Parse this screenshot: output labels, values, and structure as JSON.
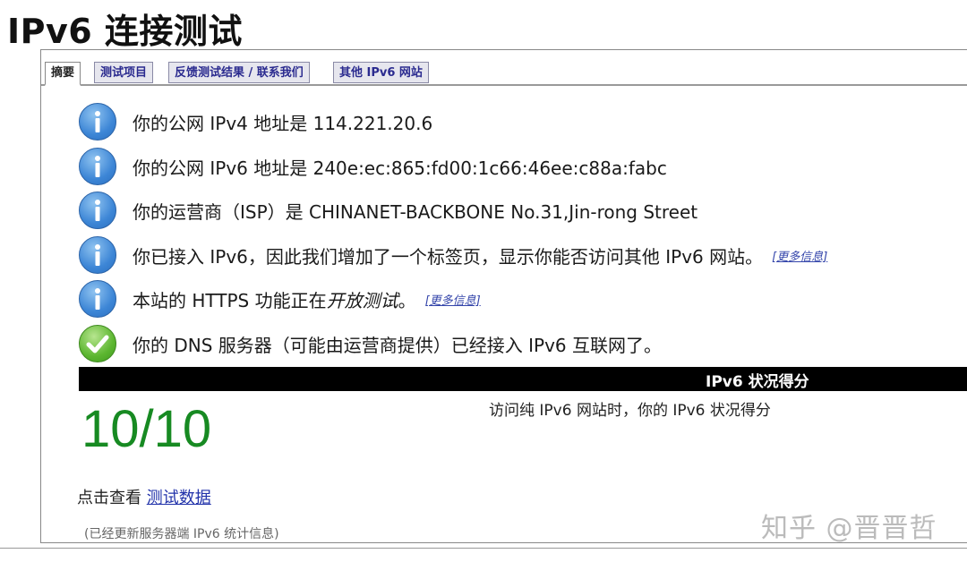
{
  "page": {
    "title": "IPv6 连接测试"
  },
  "tabs": [
    {
      "label": "摘要"
    },
    {
      "label": "测试项目"
    },
    {
      "label": "反馈测试结果 / 联系我们"
    },
    {
      "label": "其他 IPv6 网站"
    }
  ],
  "info": [
    {
      "icon": "info-icon",
      "text": "你的公网 IPv4 地址是 114.221.20.6"
    },
    {
      "icon": "info-icon",
      "text": "你的公网 IPv6 地址是 240e:ec:865:fd00:1c66:46ee:c88a:fabc"
    },
    {
      "icon": "info-icon",
      "text": "你的运营商（ISP）是 CHINANET-BACKBONE No.31,Jin-rong Street"
    },
    {
      "icon": "info-icon",
      "text": "你已接入 IPv6，因此我们增加了一个标签页，显示你能否访问其他 IPv6 网站。",
      "link": "[更多信息]"
    },
    {
      "icon": "info-icon",
      "text_before": "本站的 HTTPS 功能正在",
      "text_italic": "开放测试",
      "text_after": "。",
      "link": "[更多信息]"
    },
    {
      "icon": "check-icon",
      "text": "你的 DNS 服务器（可能由运营商提供）已经接入 IPv6 互联网了。"
    }
  ],
  "score": {
    "header": "IPv6 状况得分",
    "value": "10/10",
    "description": "访问纯 IPv6 网站时，你的 IPv6 状况得分"
  },
  "data_line": {
    "prefix": "点击查看 ",
    "link": "测试数据"
  },
  "footnote": "(已经更新服务器端 IPv6 统计信息)",
  "watermark": "知乎 @晋晋哲",
  "colors": {
    "score": "#178a22",
    "header_bg": "#000000",
    "link": "#2233aa"
  }
}
